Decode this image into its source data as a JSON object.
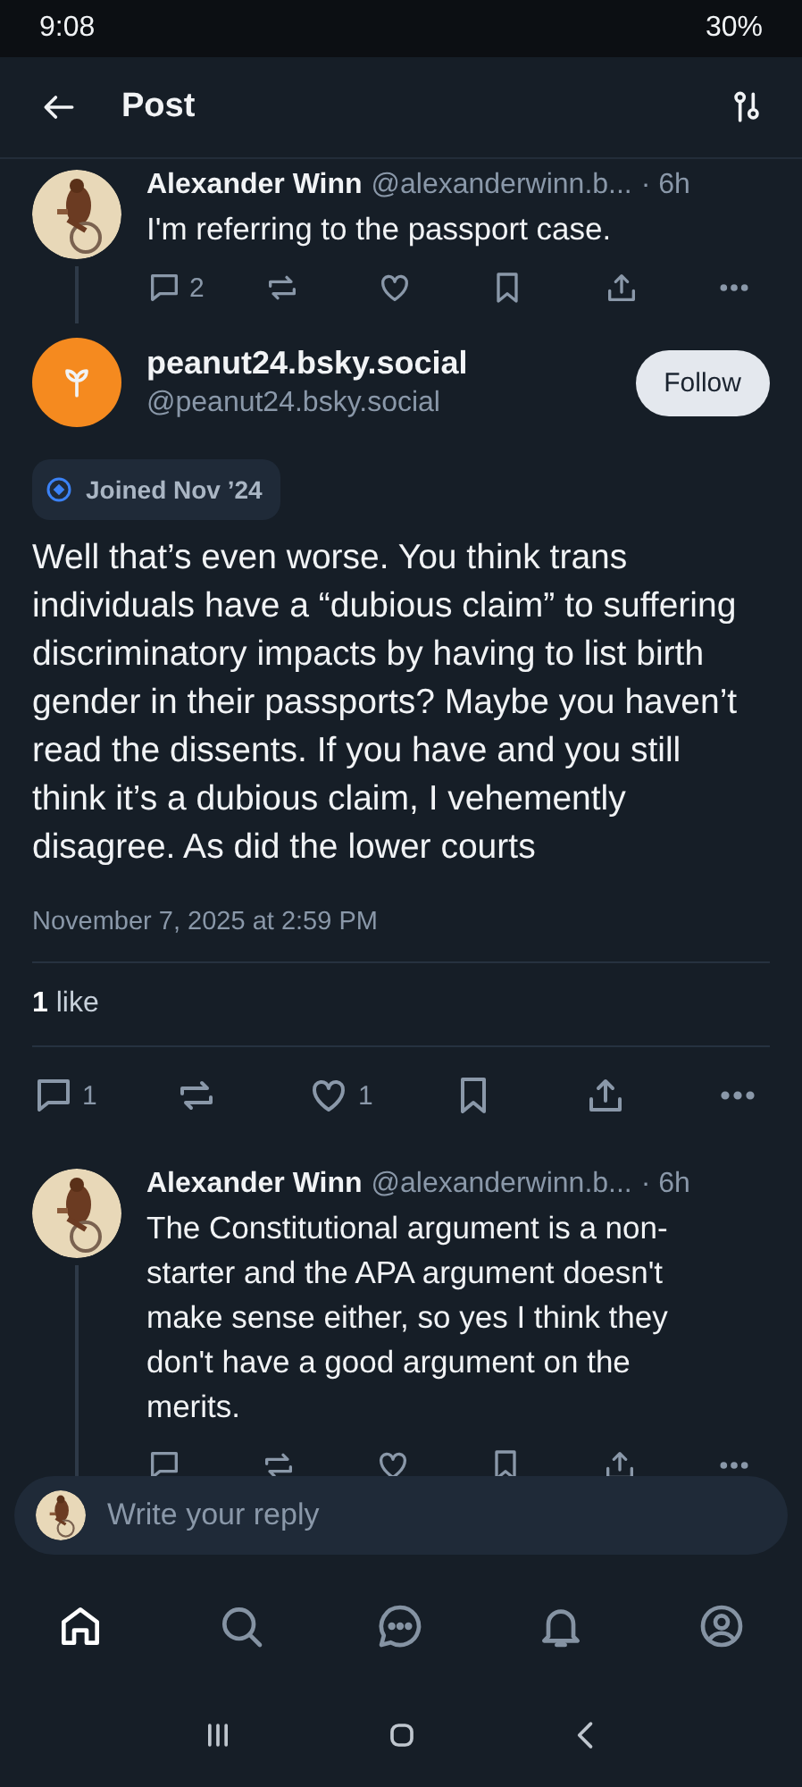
{
  "status_bar": {
    "time": "9:08",
    "battery": "30%"
  },
  "header": {
    "title": "Post"
  },
  "parent": {
    "author": "Alexander Winn",
    "handle": "@alexanderwinn.b...",
    "time": "· 6h",
    "text": "I'm referring to the passport case.",
    "actions": [
      {
        "kind": "reply",
        "count": "2"
      },
      {
        "kind": "repost"
      },
      {
        "kind": "like"
      },
      {
        "kind": "bookmark"
      },
      {
        "kind": "share"
      },
      {
        "kind": "more"
      }
    ]
  },
  "main": {
    "author": "peanut24.bsky.social",
    "handle": "@peanut24.bsky.social",
    "follow": "Follow",
    "joined": "Joined Nov ’24",
    "text": "Well that’s even worse. You think trans individuals have a “dubious claim” to suffering discriminatory impacts by having to list birth gender in their passports? Maybe you haven’t read the dissents. If you have and you still think it’s a dubious claim, I vehemently disagree. As did the lower courts",
    "date": "November 7, 2025 at 2:59 PM",
    "likes": "**1** like",
    "actions": [
      {
        "kind": "reply",
        "count": "1"
      },
      {
        "kind": "repost"
      },
      {
        "kind": "like",
        "count": "1"
      },
      {
        "kind": "bookmark"
      },
      {
        "kind": "share"
      },
      {
        "kind": "more"
      }
    ]
  },
  "reply": {
    "author": "Alexander Winn",
    "handle": "@alexanderwinn.b...",
    "time": "· 6h",
    "text": "The Constitutional argument is a non-starter and the APA argument doesn't make sense either, so yes I think they don't have a good argument on the merits.",
    "actions": [
      {
        "kind": "reply"
      },
      {
        "kind": "repost"
      },
      {
        "kind": "like"
      },
      {
        "kind": "bookmark"
      },
      {
        "kind": "share"
      },
      {
        "kind": "more"
      }
    ]
  },
  "composer": {
    "placeholder": "Write your reply"
  },
  "tabbar": [
    {
      "kind": "home",
      "selected": true
    },
    {
      "kind": "search",
      "selected": false
    },
    {
      "kind": "chat",
      "selected": false
    },
    {
      "kind": "bell",
      "selected": false
    },
    {
      "kind": "profile",
      "selected": false
    }
  ]
}
